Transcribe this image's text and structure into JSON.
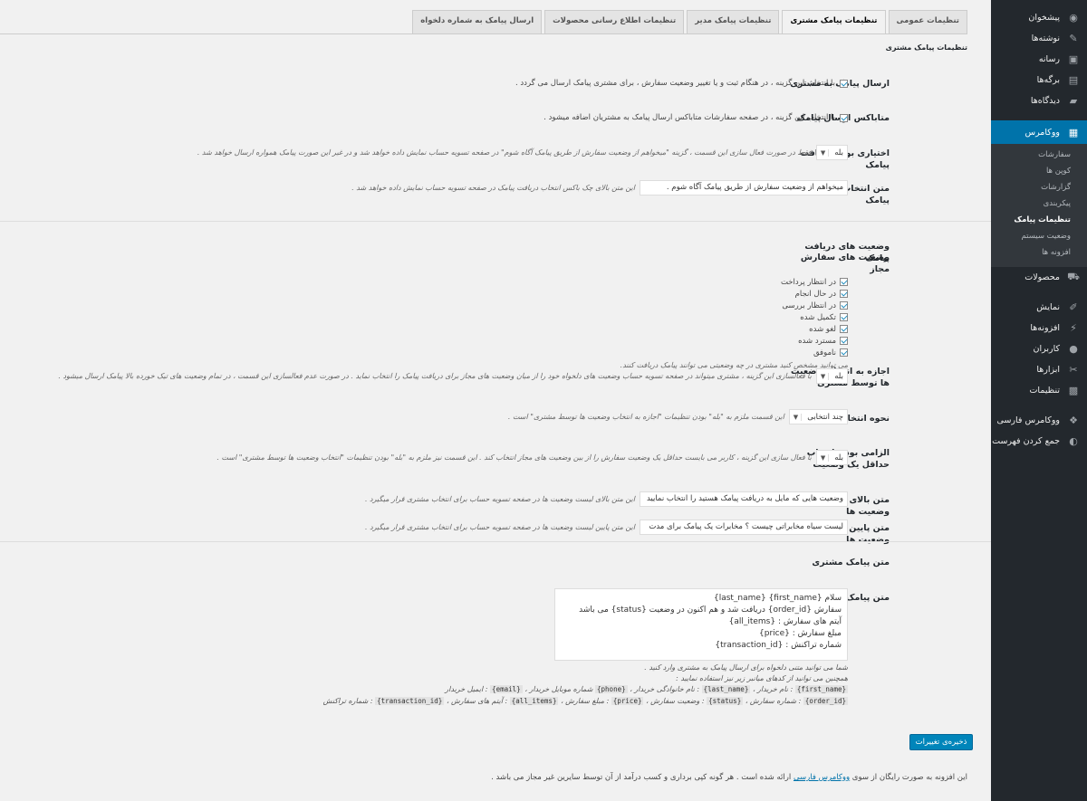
{
  "sidebar": {
    "items": [
      {
        "label": "پیشخوان",
        "icon": "dashboard-icon"
      },
      {
        "label": "نوشته‌ها",
        "icon": "pin-icon"
      },
      {
        "label": "رسانه",
        "icon": "media-icon"
      },
      {
        "label": "برگه‌ها",
        "icon": "page-icon"
      },
      {
        "label": "دیدگاه‌ها",
        "icon": "comment-icon"
      }
    ],
    "woo": {
      "label": "ووکامرس",
      "icon": "woo-icon"
    },
    "sub": [
      "سفارشات",
      "کوپن ها",
      "گزارشات",
      "پیکربندی",
      "تنظیمات پیامک",
      "وضعیت سیستم",
      "افزونه ها"
    ],
    "items2": [
      {
        "label": "محصولات",
        "icon": "cart-icon"
      },
      {
        "label": "نمایش",
        "icon": "brush-icon"
      },
      {
        "label": "افزونه‌ها",
        "icon": "plugin-icon"
      },
      {
        "label": "کاربران",
        "icon": "user-icon"
      },
      {
        "label": "ابزارها",
        "icon": "wrench-icon"
      },
      {
        "label": "تنظیمات",
        "icon": "settings-icon"
      },
      {
        "label": "ووکامرس فارسی",
        "icon": "woo-fa-icon"
      },
      {
        "label": "جمع کردن فهرست",
        "icon": "collapse-icon"
      }
    ]
  },
  "tabs": [
    "تنظیمات عمومی",
    "تنظیمات پیامک مشتری",
    "تنظیمات پیامک مدیر",
    "تنظیمات اطلاع رسانی محصولات",
    "ارسال پیامک به شماره دلخواه"
  ],
  "section_title": "تنظیمات پیامک مشتری",
  "rows": {
    "send": {
      "label": "ارسال پیامک به مشتری",
      "text": "با انتخاب این گزینه ، در هنگام ثبت و یا تغییر وضعیت سفارش ، برای مشتری پیامک ارسال می گردد ."
    },
    "metabox": {
      "label": "متاباکس ارسال پیامک",
      "text": "با انتخاب این گزینه ، در صفحه سفارشات متاباکس ارسال پیامک به مشتریان اضافه میشود ."
    },
    "optional": {
      "label": "اختیاری بودن دریافت پیامک",
      "select": "بله",
      "desc": "فقط در صورت فعال سازی این قسمت ، گزینه \"میخواهم از وضعیت سفارش از طریق پیامک آگاه شوم\" در صفحه تسویه حساب نمایش داده خواهد شد و در غیر این صورت پیامک همواره ارسال خواهد شد ."
    },
    "optin_text": {
      "label": "متن انتخاب دریافت پیامک",
      "value": "میخواهم از وضعیت سفارش از طریق پیامک آگاه شوم .",
      "desc": "این متن بالای چک باکس انتخاب دریافت پیامک در صفحه تسویه حساب نمایش داده خواهد شد ."
    },
    "statuses_heading": "وضعیت های دریافت پیامک",
    "allowed": {
      "label": "وضعیت های سفارش مجاز",
      "list": [
        "در انتظار پرداخت",
        "در حال انجام",
        "در انتظار بررسی",
        "تکمیل شده",
        "لغو شده",
        "مسترد شده",
        "ناموفق"
      ],
      "desc": "می توانید مشخص کنید مشتری در چه وضعیتی می توانند پیامک دریافت کنند."
    },
    "allow_choose": {
      "label": "اجازه به انتخاب وضعیت ها توسط مشتری",
      "select": "بله",
      "desc": "با فعالسازی این گزینه ، مشتری میتواند در صفحه تسویه حساب وضعیت های دلخواه خود را از میان وضعیت های مجاز برای دریافت پیامک را انتخاب نماید . در صورت عدم فعالسازی این قسمت ، در تمام وضعیت های تیک خورده بالا پیامک ارسال میشود ."
    },
    "choose_mode": {
      "label": "نحوه انتخاب وضعیت ها",
      "select": "چند انتخابی",
      "desc": "این قسمت ملزم به \"بله\" بودن تنظیمات \"اجازه به انتخاب وضعیت ها توسط مشتری\" است ."
    },
    "required": {
      "label": "الزامی بودن انتخاب حداقل یک وضعیت",
      "select": "بله",
      "desc": "با فعال سازی این گزینه ، کاربر می بایست حداقل یک وضعیت سفارش را از بین وضعیت های مجاز انتخاب کند . این قسمت نیز ملزم به \"بله\" بودن تنظیمات \"انتخاب وضعیت ها توسط مشتری\" است ."
    },
    "top_text": {
      "label": "متن بالای انتخاب وضعیت ها",
      "value": "وضعیت هایی که مایل به دریافت پیامک هستید را انتخاب نمایید",
      "desc": "این متن بالای لیست وضعیت ها در صفحه تسویه حساب برای انتخاب مشتری قرار میگیرد ."
    },
    "bottom_text": {
      "label": "متن پایین انتخاب وضعیت ها",
      "value": "لیست سیاه مخابراتی چیست ؟ مخابرات یک پیامک برای مدت",
      "desc": "این متن پایین لیست وضعیت ها در صفحه تسویه حساب برای انتخاب مشتری قرار میگیرد ."
    },
    "msg_heading": "متن پیامک مشتری",
    "message": {
      "label": "متن پیامک به مشتری",
      "body": "سلام {first_name} {last_name}\nسفارش {order_id} دریافت شد و هم اکنون در وضعیت {status} می باشد\nآیتم های سفارش : {all_items}\nمبلغ سفارش : {price}\nشماره تراکنش : {transaction_id}",
      "help1": "شما می توانید متنی دلخواه برای ارسال پیامک به مشتری وارد کنید .",
      "help2": "همچنین می توانید از کدهای میانبر زیر نیز استفاده نمایید :",
      "codes1": [
        [
          "{first_name}",
          " : نام خریدار ، "
        ],
        [
          "{last_name}",
          " : نام خانوادگی خریدار ، "
        ],
        [
          "{phone}",
          " شماره موبایل خریدار ، "
        ],
        [
          "{email}",
          " : ایمیل خریدار"
        ]
      ],
      "codes2": [
        [
          "{order_id}",
          " : شماره سفارش ، "
        ],
        [
          "{status}",
          " : وضعیت سفارش ، "
        ],
        [
          "{price}",
          " : مبلغ سفارش ، "
        ],
        [
          "{all_items}",
          " : آیتم های سفارش ، "
        ],
        [
          "{transaction_id}",
          " : شماره تراکنش"
        ]
      ]
    }
  },
  "save_label": "ذخیره‌ی تغییرات",
  "footer": {
    "pre": "این افزونه به صورت رایگان از سوی ",
    "link": "ووکامرس فارسی",
    "post": " ارائه شده است . هر گونه کپی برداری و کسب درآمد از آن توسط سایرین غیر مجاز می باشد ."
  },
  "colors": {
    "sidebar": "#23282d",
    "accent": "#0073aa",
    "button": "#0085ba"
  }
}
